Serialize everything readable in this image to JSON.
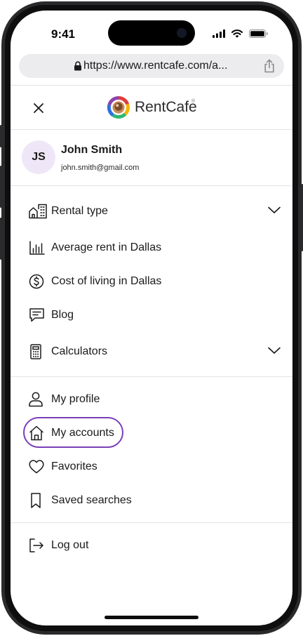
{
  "status_bar": {
    "time": "9:41"
  },
  "browser": {
    "url": "https://www.rentcafe.com/a..."
  },
  "header": {
    "brand": "RentCafe"
  },
  "user": {
    "initials": "JS",
    "name": "John Smith",
    "email": "john.smith@gmail.com"
  },
  "menu": {
    "primary": [
      {
        "label": "Rental type",
        "icon": "building-home-icon",
        "expandable": true
      },
      {
        "label": "Average rent in Dallas",
        "icon": "bar-chart-icon"
      },
      {
        "label": "Cost of living in Dallas",
        "icon": "dollar-circle-icon"
      },
      {
        "label": "Blog",
        "icon": "message-icon"
      },
      {
        "label": "Calculators",
        "icon": "calculator-icon",
        "expandable": true
      }
    ],
    "account": [
      {
        "label": "My profile",
        "icon": "user-icon"
      },
      {
        "label": "My accounts",
        "icon": "home-icon",
        "active": true
      },
      {
        "label": "Favorites",
        "icon": "heart-icon"
      },
      {
        "label": "Saved searches",
        "icon": "bookmark-icon"
      }
    ],
    "logout": {
      "label": "Log out",
      "icon": "logout-icon"
    }
  },
  "colors": {
    "accent": "#7B3FB8",
    "avatar_bg": "#EFE7F7",
    "url_bar": "#ECECEE"
  }
}
